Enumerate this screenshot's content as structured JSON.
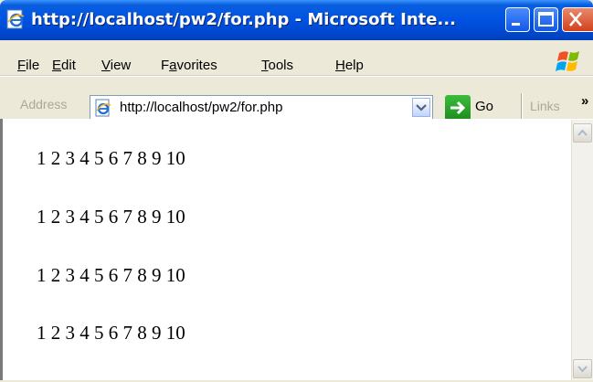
{
  "window": {
    "title": "http://localhost/pw2/for.php - Microsoft Inte..."
  },
  "menu": {
    "file": {
      "ul": "F",
      "rest": "ile"
    },
    "edit": {
      "ul": "E",
      "rest": "dit"
    },
    "view": {
      "ul": "V",
      "rest": "iew"
    },
    "favorites": {
      "pre": "F",
      "ul": "a",
      "rest": "vorites"
    },
    "tools": {
      "ul": "T",
      "rest": "ools"
    },
    "help": {
      "ul": "H",
      "rest": "elp"
    }
  },
  "address_bar": {
    "label": "Address",
    "url": "http://localhost/pw2/for.php",
    "go_label": "Go",
    "links_label": "Links",
    "overflow": "»"
  },
  "content": {
    "lines": [
      "1 2 3 4 5 6 7 8 9 10",
      "1 2 3 4 5 6 7 8 9 10",
      "1 2 3 4 5 6 7 8 9 10",
      "1 2 3 4 5 6 7 8 9 10"
    ]
  },
  "colors": {
    "titlebar": "#0054e3",
    "close_button": "#d2411c",
    "chrome": "#ece9d8"
  }
}
